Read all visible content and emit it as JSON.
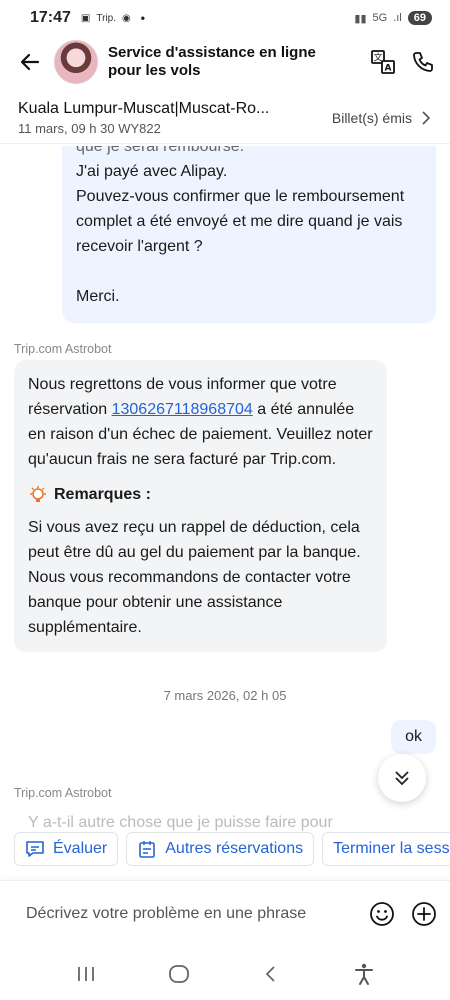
{
  "status_bar": {
    "time": "17:47",
    "app_label": "Trip.",
    "battery": "69"
  },
  "header": {
    "title": "Service d'assistance en ligne pour les vols"
  },
  "booking": {
    "route": "Kuala Lumpur-Muscat|Muscat-Ro...",
    "details": "11 mars, 09 h 30 WY822",
    "status": "Billet(s) émis"
  },
  "user_message": {
    "cut_line": "que je serai remboursé.",
    "lines": [
      "J'ai payé avec Alipay.",
      "Pouvez-vous confirmer que le remboursement complet a été envoyé et me dire quand je vais recevoir l'argent ?",
      "",
      "Merci."
    ]
  },
  "bot": {
    "sender": "Trip.com Astrobot",
    "intro_before": "Nous regrettons de vous informer que votre réservation ",
    "booking_number": "1306267118968704",
    "intro_after": " a été annulée en raison d'un échec de paiement. Veuillez noter qu'aucun frais ne sera facturé par Trip.com.",
    "remarks_title": "Remarques :",
    "remarks_body": "Si vous avez reçu un rappel de déduction, cela peut être dû au gel du paiement par la banque. Nous vous recommandons de contacter votre banque pour obtenir une assistance supplémentaire."
  },
  "date_separator": "7 mars 2026, 02 h 05",
  "user_reply": "ok",
  "bot2": {
    "sender": "Trip.com Astrobot",
    "preview": "Y a-t-il autre chose que je puisse faire pour"
  },
  "quick_actions": [
    {
      "label": "Évaluer",
      "icon": "rate-icon"
    },
    {
      "label": "Autres réservations",
      "icon": "calendar-icon"
    },
    {
      "label": "Terminer la session",
      "icon": "none"
    }
  ],
  "input": {
    "placeholder": "Décrivez votre problème en une phrase"
  },
  "colors": {
    "accent": "#2463d6",
    "user_bubble": "#eef4ff",
    "bot_bubble": "#f3f4f6"
  }
}
